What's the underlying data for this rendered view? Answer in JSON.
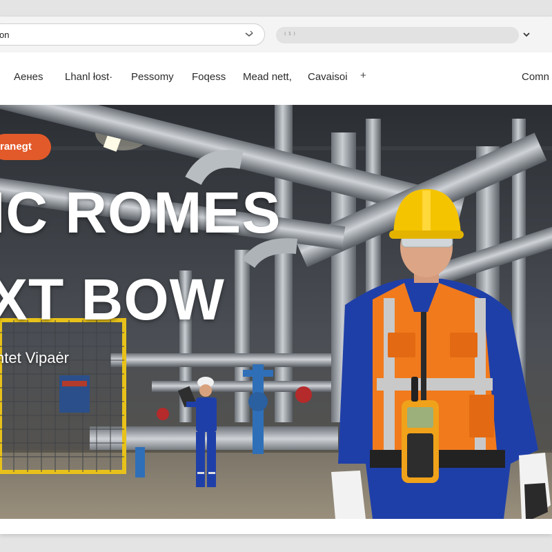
{
  "browser": {
    "url_text": "on",
    "search_glyph": "⁽¹⁾"
  },
  "nav": {
    "items": [
      {
        "label": "Aeнes"
      },
      {
        "label": "Lhanl łost·"
      },
      {
        "label": "Pessomy"
      },
      {
        "label": "Foqess"
      },
      {
        "label": "Mead nett,"
      },
      {
        "label": "Cavaisoi"
      },
      {
        "label": "Comn"
      }
    ],
    "plus_label": "+"
  },
  "hero": {
    "badge": "ranegt",
    "headline_line1": "IC ROMES",
    "headline_line2": "XT BOW",
    "subtitle": "ntet Vipaėr"
  },
  "colors": {
    "accent": "#e35a2a",
    "vest": "#f07a1c",
    "coverall": "#1f3fa8",
    "helmet": "#f5c400"
  },
  "icons": [
    "dropdown-icon",
    "chevron-down-icon"
  ]
}
